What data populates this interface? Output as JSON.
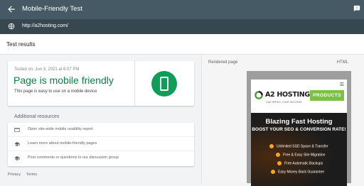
{
  "appbar": {
    "title": "Mobile-Friendly Test"
  },
  "url": "http://a2hosting.com/",
  "results_label": "Test results",
  "result_card": {
    "tested_on": "Tested on: Jun 3, 2021 at 6:07 PM",
    "headline": "Page is mobile friendly",
    "subtext": "This page is easy to use on a mobile device"
  },
  "additional_resources": {
    "heading": "Additional resources",
    "items": [
      {
        "icon": "browser-icon",
        "label": "Open site-wide mobile usability report"
      },
      {
        "icon": "school-icon",
        "label": "Learn more about mobile-friendly pages"
      },
      {
        "icon": "school-icon",
        "label": "Post comments or questions to our discussion group"
      }
    ]
  },
  "footer": {
    "privacy": "Privacy",
    "terms": "Terms"
  },
  "rendered": {
    "label": "Rendered page",
    "html_tab": "HTML",
    "site": {
      "logo_name": "A2 HOSTING",
      "logo_tagline": "OUR SPEED, YOUR SUCCESS",
      "products_button": "PRODUCTS",
      "hero_title": "Blazing Fast Hosting",
      "hero_subtitle": "BOOST YOUR SEO & CONVERSION RATE!",
      "features": [
        "Unlimited SSD Space & Transfer",
        "Free & Easy Site Migration",
        "Free Automatic Backups",
        "Easy Money Back Guarantee"
      ]
    }
  },
  "colors": {
    "appbar": "#455a64",
    "urlbar": "#37474f",
    "success_green": "#0b8043",
    "badge_green": "#0f9d58",
    "products_green": "#7cc143"
  }
}
